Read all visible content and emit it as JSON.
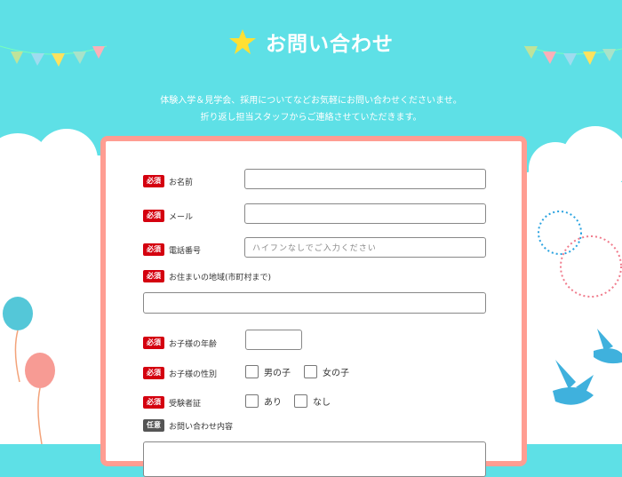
{
  "header": {
    "title": "お問い合わせ",
    "intro_line1": "体験入学＆見学会、採用についてなどお気軽にお問い合わせくださいませ。",
    "intro_line2": "折り返し担当スタッフからご連絡させていただきます。"
  },
  "badges": {
    "required": "必須",
    "optional": "任意"
  },
  "form": {
    "name_label": "お名前",
    "email_label": "メール",
    "phone_label": "電話番号",
    "phone_placeholder": "ハイフンなしでご入力ください",
    "address_label": "お住まいの地域(市町村まで)",
    "child_age_label": "お子様の年齢",
    "child_gender_label": "お子様の性別",
    "gender_options": [
      "男の子",
      "女の子"
    ],
    "exam_card_label": "受験者証",
    "exam_options": [
      "あり",
      "なし"
    ],
    "inquiry_label": "お問い合わせ内容"
  },
  "colors": {
    "background": "#5ee0e6",
    "card_border": "#ff9d92",
    "required_badge": "#d4000f",
    "optional_badge": "#555555"
  }
}
